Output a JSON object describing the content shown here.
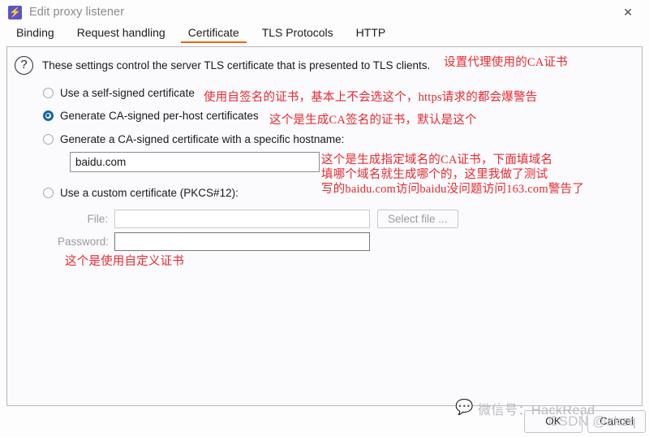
{
  "window": {
    "title": "Edit proxy listener",
    "app_icon": "lightning-bolt-icon",
    "close_label": "✕"
  },
  "tabs": [
    {
      "label": "Binding",
      "active": false
    },
    {
      "label": "Request handling",
      "active": false
    },
    {
      "label": "Certificate",
      "active": true
    },
    {
      "label": "TLS Protocols",
      "active": false
    },
    {
      "label": "HTTP",
      "active": false
    }
  ],
  "panel": {
    "info_icon": "?",
    "info_text": "These settings control the server TLS certificate that is presented to TLS clients.",
    "options": [
      {
        "label": "Use a self-signed certificate",
        "selected": false
      },
      {
        "label": "Generate CA-signed per-host certificates",
        "selected": true
      },
      {
        "label": "Generate a CA-signed certificate with a specific hostname:",
        "selected": false
      },
      {
        "label": "Use a custom certificate (PKCS#12):",
        "selected": false
      }
    ],
    "hostname_input": {
      "value": "baidu.com",
      "placeholder": ""
    },
    "file_row": {
      "label": "File:",
      "value": "",
      "placeholder": "",
      "button_label": "Select file ..."
    },
    "password_row": {
      "label": "Password:",
      "value": "",
      "placeholder": ""
    }
  },
  "annotations": {
    "ca_cert_title": "设置代理使用的CA证书",
    "self_signed": "使用自签名的证书，基本上不会选这个，https请求的都会爆警告",
    "per_host": "这个是生成CA签名的证书，默认是这个",
    "specific_hostname_line1": "这个是生成指定域名的CA证书，下面填域名",
    "specific_hostname_line2": "填哪个域名就生成哪个的，这里我做了测试",
    "specific_hostname_line3": "写的baidu.com访问baidu没问题访问163.com警告了",
    "custom_cert": "这个是使用自定义证书"
  },
  "footer": {
    "ok_label": "OK",
    "cancel_label": "Cancel"
  },
  "watermarks": {
    "wechat": "微信号：HackRead",
    "wechat_icon": "speech-bubble-icon",
    "csdn": "CSDN @zkzq"
  },
  "colors": {
    "accent": "#e8650d",
    "radio_selected": "#11699e",
    "annotation": "#e8292f",
    "app_icon_bg": "#5b53c9"
  }
}
